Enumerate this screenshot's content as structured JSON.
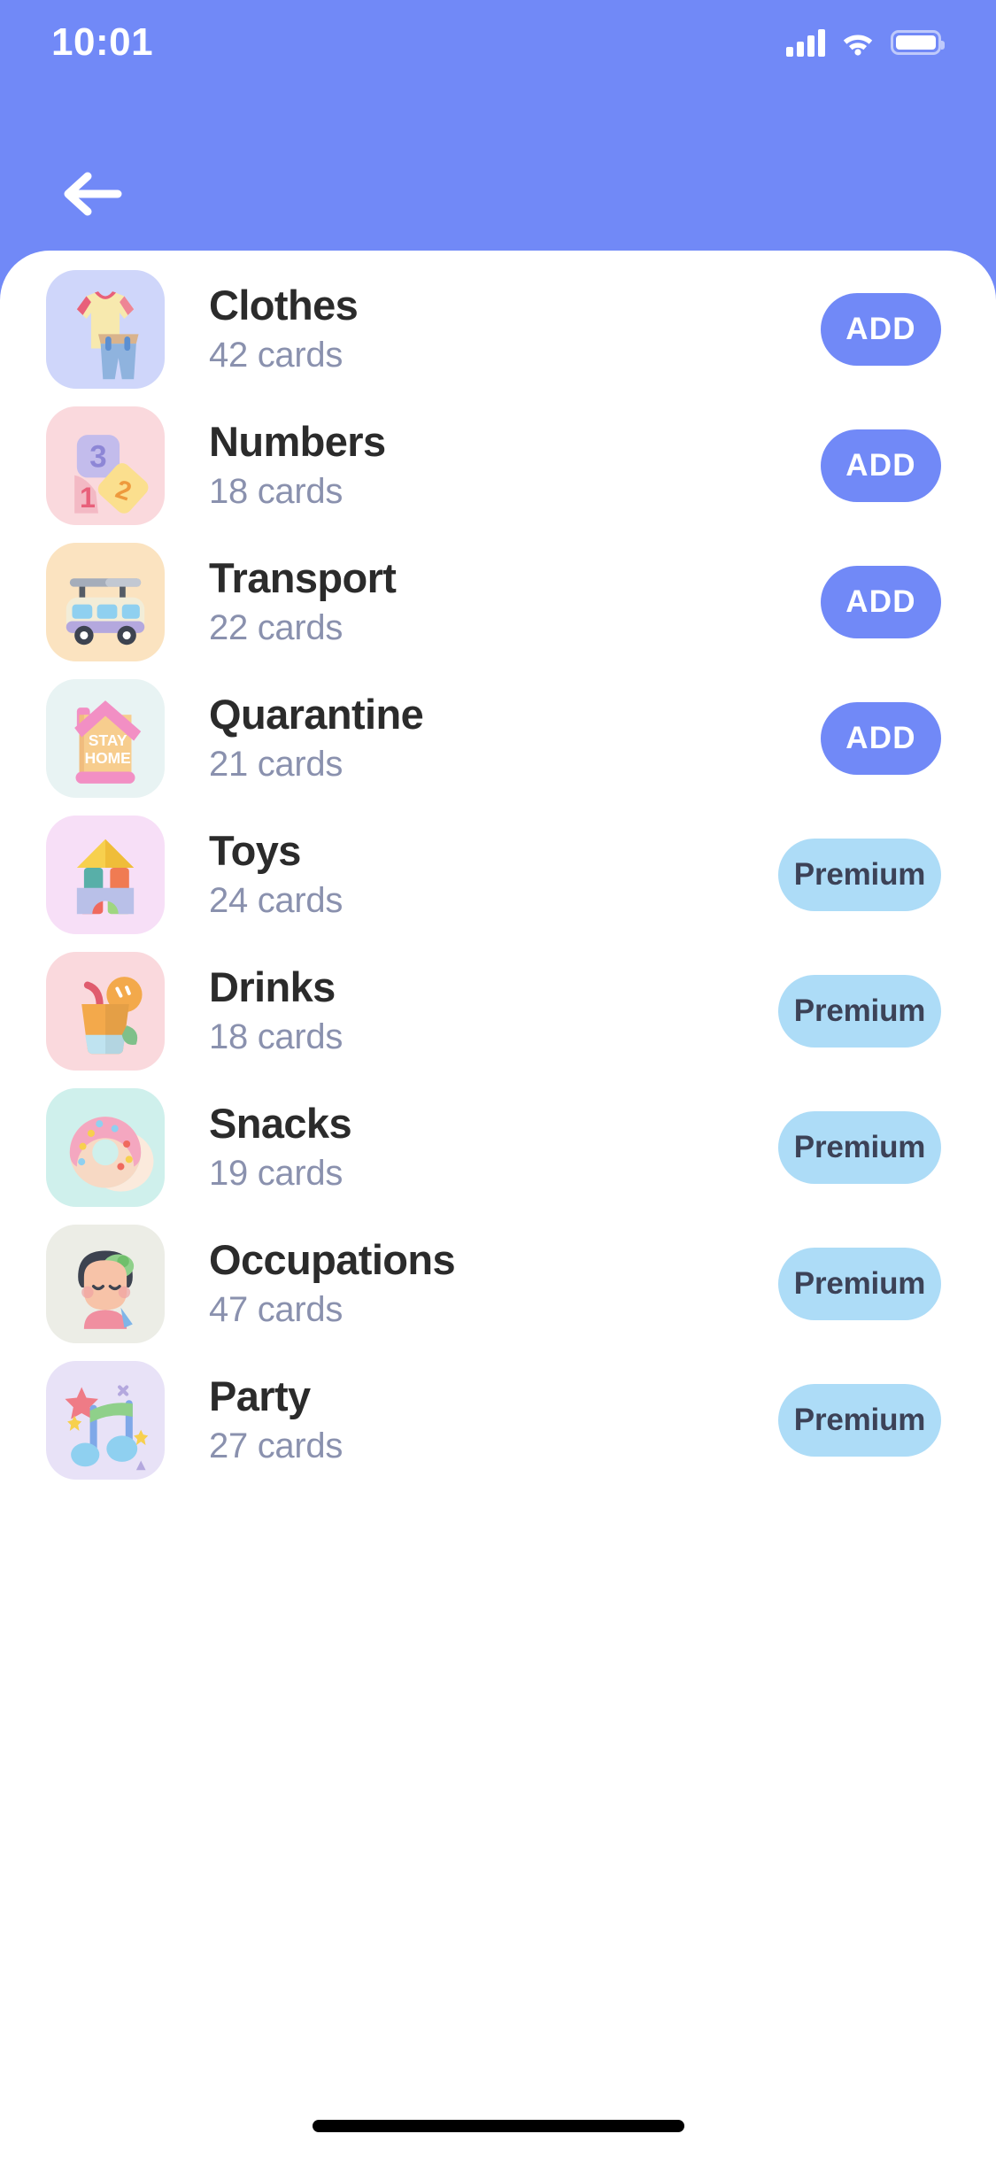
{
  "status_bar": {
    "time": "10:01",
    "signal_icon": "cellular-signal-icon",
    "wifi_icon": "wifi-icon",
    "battery_icon": "battery-icon"
  },
  "header": {
    "back_icon": "back-arrow-icon"
  },
  "theme": {
    "header_background": "#7189F7",
    "sheet_background": "#ffffff",
    "add_button_color": "#7189F7",
    "add_button_text_color": "#ffffff",
    "premium_button_color": "#ADDCF7",
    "premium_button_text_color": "#3C4257",
    "title_color": "#2B2B2B",
    "subtitle_color": "#8A91AE"
  },
  "categories": [
    {
      "name": "Clothes",
      "cards": "42 cards",
      "action": "ADD",
      "action_type": "add",
      "icon": "tshirt-and-jeans-icon",
      "tile_color": "#CFD6FA"
    },
    {
      "name": "Numbers",
      "cards": "18 cards",
      "action": "ADD",
      "action_type": "add",
      "icon": "number-blocks-icon",
      "tile_color": "#FAD9DD"
    },
    {
      "name": "Transport",
      "cards": "22 cards",
      "action": "ADD",
      "action_type": "add",
      "icon": "bus-icon",
      "tile_color": "#FBE3C0"
    },
    {
      "name": "Quarantine",
      "cards": "21 cards",
      "action": "ADD",
      "action_type": "add",
      "icon": "stay-home-house-icon",
      "tile_color": "#E8F3F3"
    },
    {
      "name": "Toys",
      "cards": "24 cards",
      "action": "Premium",
      "action_type": "premium",
      "icon": "building-blocks-icon",
      "tile_color": "#F7DFF7"
    },
    {
      "name": "Drinks",
      "cards": "18 cards",
      "action": "Premium",
      "action_type": "premium",
      "icon": "juice-glass-icon",
      "tile_color": "#FAD9DD"
    },
    {
      "name": "Snacks",
      "cards": "19 cards",
      "action": "Premium",
      "action_type": "premium",
      "icon": "donut-icon",
      "tile_color": "#CFF0EC"
    },
    {
      "name": "Occupations",
      "cards": "47 cards",
      "action": "Premium",
      "action_type": "premium",
      "icon": "person-artist-icon",
      "tile_color": "#ECEDE6"
    },
    {
      "name": "Party",
      "cards": "27 cards",
      "action": "Premium",
      "action_type": "premium",
      "icon": "music-notes-icon",
      "tile_color": "#E8E2F7"
    }
  ]
}
